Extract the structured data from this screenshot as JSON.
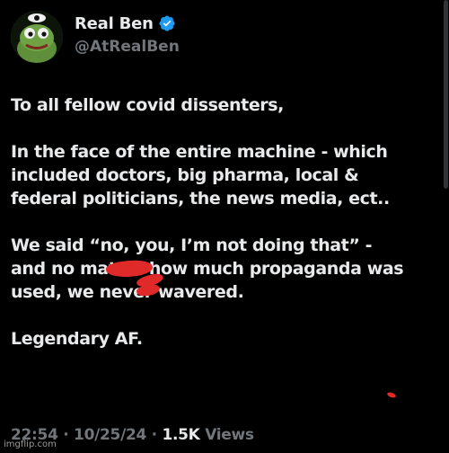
{
  "author": {
    "display_name": "Real Ben",
    "handle": "@AtRealBen",
    "avatar_icon": "frog-avatar-icon",
    "verified_icon": "verified-badge-icon",
    "verified_color": "#1d9bf0"
  },
  "tweet": {
    "paragraphs": [
      {
        "lines": [
          "To all fellow covid dissenters,"
        ]
      },
      {
        "lines": [
          "In the face of the entire machine - which",
          "included doctors, big pharma, local &",
          "federal politicians, the news media, ect.."
        ]
      },
      {
        "lines": [
          "We said “no,        you, I’m not doing that” -",
          "and no matter how much propaganda was",
          "used, we never wavered."
        ]
      },
      {
        "lines": [
          "Legendary AF."
        ]
      }
    ]
  },
  "meta": {
    "time": "22:54",
    "separator": "·",
    "date": "10/25/24",
    "views_count": "1.5K",
    "views_label": "Views"
  },
  "watermark": "imgflip.com",
  "colors": {
    "background": "#000000",
    "text": "#e7e9ea",
    "muted": "#71767b",
    "redaction": "#e02a2a"
  }
}
